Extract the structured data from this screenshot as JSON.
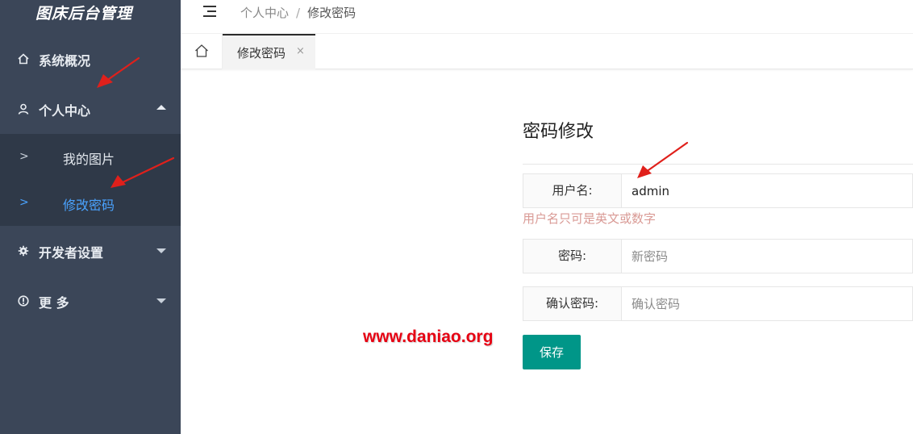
{
  "app": {
    "title": "图床后台管理"
  },
  "sidebar": {
    "items": [
      {
        "label": "系统概况",
        "icon": "home-icon"
      },
      {
        "label": "个人中心",
        "icon": "user-icon",
        "expanded": true
      },
      {
        "label": "开发者设置",
        "icon": "gear-icon"
      },
      {
        "label": "更 多",
        "icon": "info-icon"
      }
    ],
    "submenu": [
      {
        "label": "我的图片"
      },
      {
        "label": "修改密码",
        "active": true
      }
    ]
  },
  "breadcrumb": {
    "parent": "个人中心",
    "separator": "/",
    "current": "修改密码"
  },
  "tabs": [
    {
      "label": "修改密码",
      "close": "×"
    }
  ],
  "form": {
    "title": "密码修改",
    "username_label": "用户名:",
    "username_value": "admin",
    "username_hint": "用户名只可是英文或数字",
    "password_label": "密码:",
    "password_placeholder": "新密码",
    "confirm_label": "确认密码:",
    "confirm_placeholder": "确认密码",
    "save_label": "保存"
  },
  "watermark": "www.daniao.org",
  "colors": {
    "sidebar": "#3b4658",
    "submenu": "#2f3948",
    "active_link": "#4aa3ff",
    "primary_button": "#009688",
    "hint": "#d99a95",
    "annotation_arrow": "#e0201b"
  }
}
